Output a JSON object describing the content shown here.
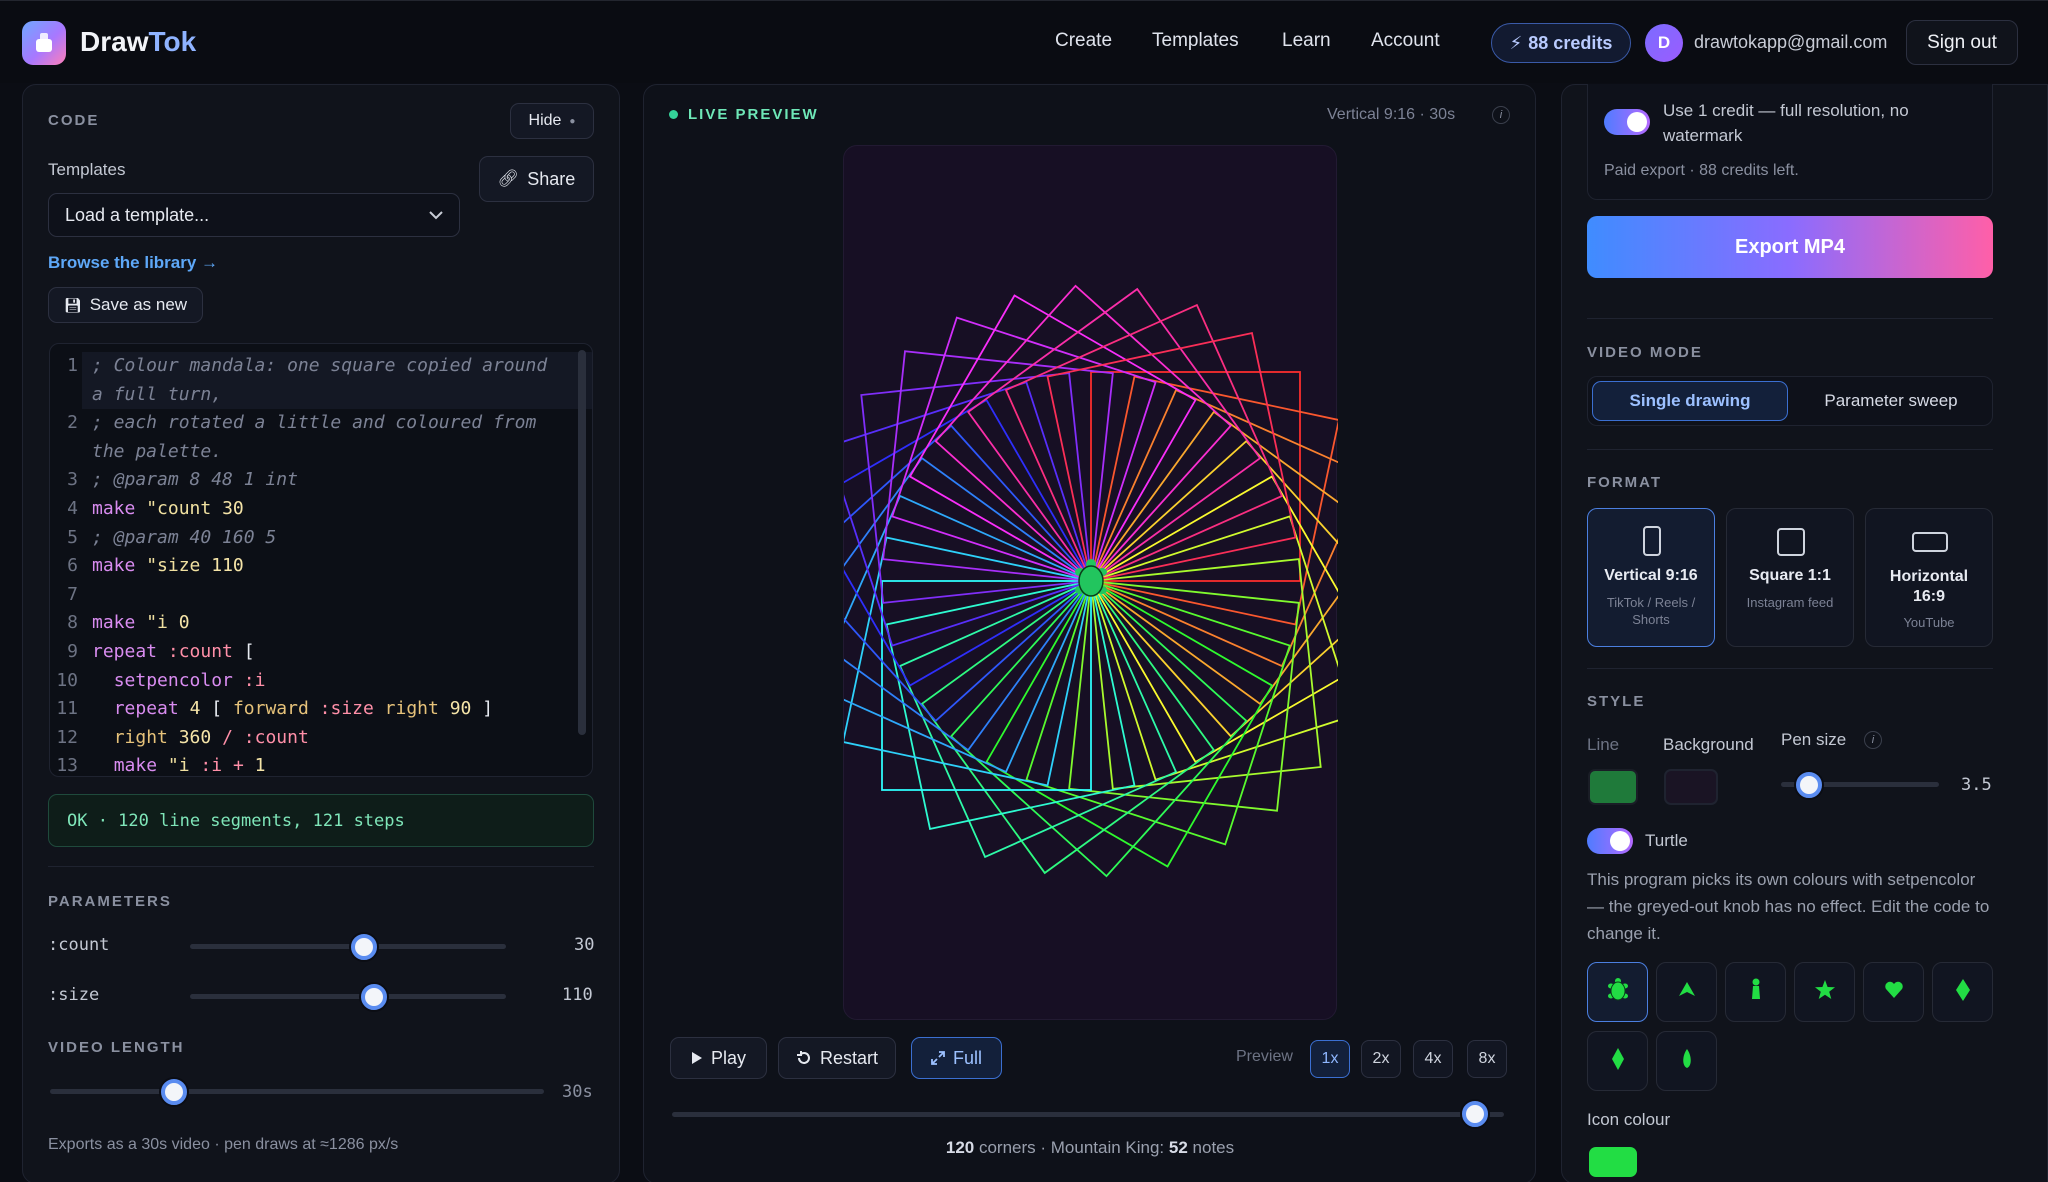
{
  "header": {
    "brand_main": "Draw",
    "brand_accent": "Tok",
    "nav": [
      "Create",
      "Templates",
      "Learn",
      "Account"
    ],
    "credits": "88 credits",
    "avatar_initial": "D",
    "email": "drawtokapp@gmail.com",
    "signout": "Sign out"
  },
  "code_panel": {
    "title": "CODE",
    "hide": "Hide",
    "templates_label": "Templates",
    "share": "Share",
    "template_select": "Load a template...",
    "browse": "Browse the library →",
    "save_as_new": "Save as new",
    "status": "OK · 120 line segments, 121 steps",
    "code_lines": [
      {
        "n": "1",
        "text": "; Colour mandala: one square copied around"
      },
      {
        "n": "",
        "text": "a full turn,"
      },
      {
        "n": "2",
        "text": "; each rotated a little and coloured from"
      },
      {
        "n": "",
        "text": "the palette."
      },
      {
        "n": "3",
        "text": "; @param 8 48 1 int"
      },
      {
        "n": "4",
        "text": "make \"count 30"
      },
      {
        "n": "5",
        "text": "; @param 40 160 5"
      },
      {
        "n": "6",
        "text": "make \"size 110"
      },
      {
        "n": "7",
        "text": ""
      },
      {
        "n": "8",
        "text": "make \"i 0"
      },
      {
        "n": "9",
        "text": "repeat :count ["
      },
      {
        "n": "10",
        "text": "  setpencolor :i"
      },
      {
        "n": "11",
        "text": "  repeat 4 [ forward :size right 90 ]"
      },
      {
        "n": "12",
        "text": "  right 360 / :count"
      },
      {
        "n": "13",
        "text": "  make \"i :i + 1"
      }
    ]
  },
  "parameters": {
    "title": "PARAMETERS",
    "items": [
      {
        "name": ":count",
        "value": "30",
        "min": 8,
        "max": 48,
        "current": 30
      },
      {
        "name": ":size",
        "value": "110",
        "min": 40,
        "max": 160,
        "current": 110
      }
    ]
  },
  "video_length": {
    "title": "VIDEO LENGTH",
    "value": "30s",
    "fraction": 0.25,
    "note": "Exports as a 30s video · pen draws at ≈1286 px/s"
  },
  "preview": {
    "title": "LIVE PREVIEW",
    "meta": "Vertical 9:16 · 30s",
    "info": "i",
    "play": "Play",
    "restart": "Restart",
    "full": "Full",
    "preview_label": "Preview",
    "speeds": [
      "1x",
      "2x",
      "4x",
      "8x"
    ],
    "active_speed": "1x",
    "progress": 1.0,
    "footer_corners": "120",
    "footer_mid": " corners · Mountain King: ",
    "footer_notes": "52",
    "footer_end": " notes",
    "colors": {
      "canvas": "#170f24",
      "turtle": "#22c55e"
    }
  },
  "export": {
    "toggle_text": "Use 1 credit — full resolution, no watermark",
    "paid_note": "Paid export · 88 credits left.",
    "button": "Export MP4"
  },
  "video_mode": {
    "title": "VIDEO MODE",
    "options": [
      "Single drawing",
      "Parameter sweep"
    ],
    "active": "Single drawing"
  },
  "format": {
    "title": "FORMAT",
    "cards": [
      {
        "title": "Vertical 9:16",
        "sub": "TikTok / Reels / Shorts",
        "active": true
      },
      {
        "title": "Square 1:1",
        "sub": "Instagram feed",
        "active": false
      },
      {
        "title": "Horizontal 16:9",
        "sub": "YouTube",
        "active": false
      }
    ]
  },
  "style": {
    "title": "STYLE",
    "line_label": "Line",
    "background_label": "Background",
    "pen_label": "Pen size",
    "pen_info": "i",
    "pen_value": "3.5",
    "pen_fraction": 0.18,
    "line_color": "#1f7a3a",
    "background_color": "#1a1424",
    "turtle_label": "Turtle",
    "note": "This program picks its own colours with setpencolor — the greyed-out knob has no effect. Edit the code to change it.",
    "icons": [
      "turtle-icon",
      "arrow-icon",
      "pawn-icon",
      "star-icon",
      "heart-icon",
      "diamond-icon",
      "spade-icon",
      "drop-icon"
    ],
    "icon_colour_label": "Icon colour",
    "icon_colour": "#22dd44"
  }
}
